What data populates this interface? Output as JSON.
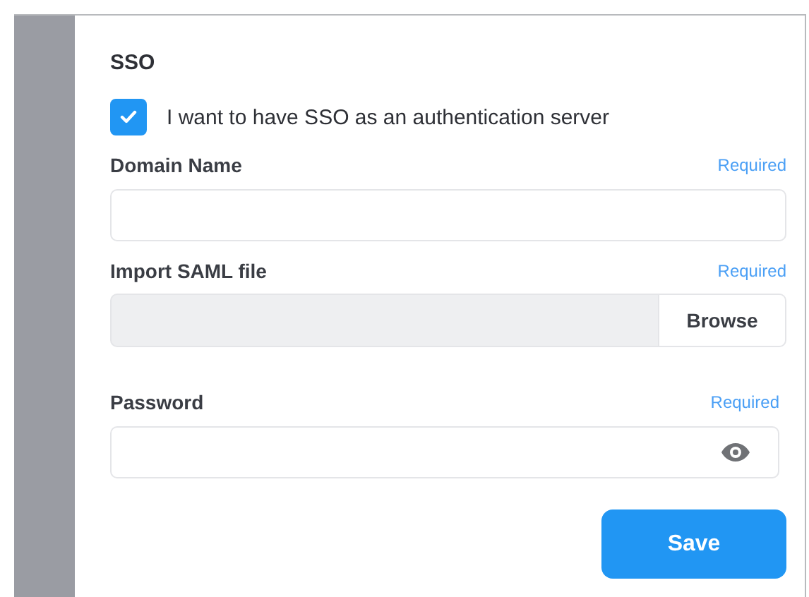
{
  "section": {
    "title": "SSO"
  },
  "sso_checkbox": {
    "label": "I want to have SSO as an authentication server",
    "checked": true
  },
  "fields": [
    {
      "kind": "text",
      "label": "Domain Name",
      "required": "Required"
    },
    {
      "kind": "file",
      "label": "Import SAML file",
      "required": "Required",
      "button": "Browse"
    },
    {
      "kind": "password",
      "label": "Password",
      "required": "Required"
    }
  ],
  "buttons": [
    {
      "label": "Save"
    }
  ]
}
